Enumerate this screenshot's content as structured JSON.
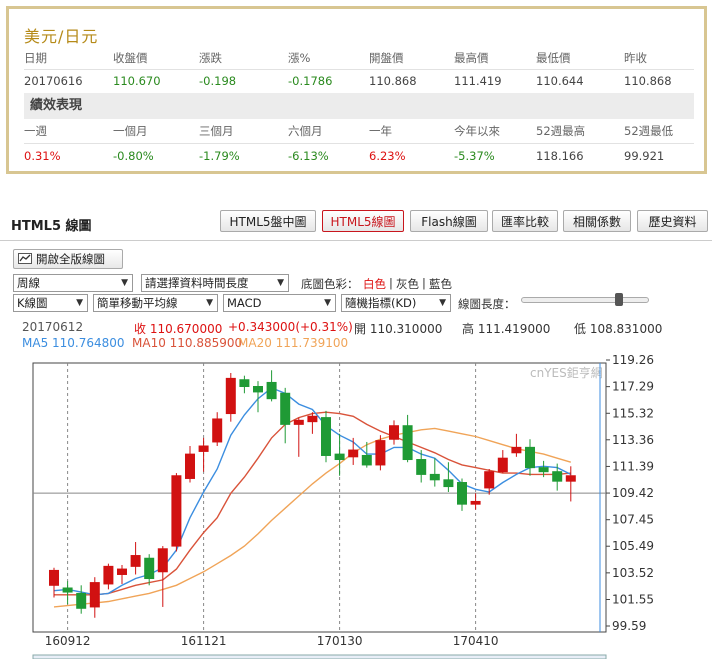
{
  "quote": {
    "title": "美元/日元",
    "headers": [
      "日期",
      "收盤價",
      "漲跌",
      "漲%",
      "開盤價",
      "最高價",
      "最低價",
      "昨收"
    ],
    "values": [
      "20170616",
      "110.670",
      "-0.198",
      "-0.1786",
      "110.868",
      "111.419",
      "110.644",
      "110.868"
    ],
    "perf_title": "績效表現",
    "perf_headers": [
      "一週",
      "一個月",
      "三個月",
      "六個月",
      "一年",
      "今年以來",
      "52週最高",
      "52週最低"
    ],
    "perf_values": [
      "0.31%",
      "-0.80%",
      "-1.79%",
      "-6.13%",
      "6.23%",
      "-5.37%",
      "118.166",
      "99.921"
    ]
  },
  "html5": {
    "title": "HTML5 線圖",
    "tabs": [
      "HTML5盤中圖",
      "HTML5線圖",
      "Flash線圖",
      "匯率比較",
      "相關係數",
      "歷史資料"
    ],
    "active_tab": "HTML5線圖",
    "full_button": "開啟全版線圖",
    "period_select": "周線",
    "range_select": "請選擇資料時間長度",
    "bg_label": "底圖色彩：",
    "bg_white": "白色",
    "bg_gray": "灰色",
    "bg_blue": "藍色",
    "chart_type_select": "K線圖",
    "ma_select": "簡單移動平均線",
    "indicator1_select": "MACD",
    "indicator2_select": "隨機指標(KD)",
    "length_label": "線圖長度："
  },
  "info": {
    "date": "20170612",
    "close": "收 110.670000",
    "change": "+0.343000(+0.31%)",
    "open": "開 110.310000",
    "high": "高 111.419000",
    "low": "低 108.831000",
    "ma5": "MA5 110.764800",
    "ma10": "MA10 110.885900",
    "ma20": "MA20 111.739100"
  },
  "colors": {
    "up": "#d11111",
    "down": "#1f9a35",
    "ma5": "#3c8ee0",
    "ma10": "#d9533a",
    "ma20": "#f0a458",
    "accent_border": "#d8c692",
    "title_gold": "#b58a18"
  },
  "chart_data": {
    "type": "candlestick",
    "watermark": "cnYES鉅亨網",
    "yticks": [
      "119.26",
      "117.29",
      "115.32",
      "113.36",
      "111.39",
      "109.42",
      "107.45",
      "105.49",
      "103.52",
      "101.55",
      "99.59"
    ],
    "ylim": [
      99.59,
      119.26
    ],
    "xticks": [
      {
        "label": "160912",
        "index": 1
      },
      {
        "label": "161121",
        "index": 11
      },
      {
        "label": "170130",
        "index": 21
      },
      {
        "label": "170410",
        "index": 31
      }
    ],
    "candles": [
      {
        "o": 102.6,
        "h": 103.9,
        "l": 101.7,
        "c": 103.7
      },
      {
        "o": 102.4,
        "h": 102.9,
        "l": 101.2,
        "c": 102.1
      },
      {
        "o": 102.0,
        "h": 102.6,
        "l": 100.5,
        "c": 100.9
      },
      {
        "o": 101.0,
        "h": 103.2,
        "l": 100.2,
        "c": 102.8
      },
      {
        "o": 102.7,
        "h": 104.2,
        "l": 102.3,
        "c": 104.0
      },
      {
        "o": 103.4,
        "h": 104.1,
        "l": 102.7,
        "c": 103.8
      },
      {
        "o": 104.0,
        "h": 105.8,
        "l": 103.4,
        "c": 104.8
      },
      {
        "o": 104.6,
        "h": 104.9,
        "l": 102.6,
        "c": 103.1
      },
      {
        "o": 103.6,
        "h": 105.5,
        "l": 101.0,
        "c": 105.3
      },
      {
        "o": 105.5,
        "h": 110.9,
        "l": 105.1,
        "c": 110.7
      },
      {
        "o": 110.5,
        "h": 112.9,
        "l": 110.2,
        "c": 112.3
      },
      {
        "o": 112.5,
        "h": 113.5,
        "l": 111.0,
        "c": 112.9
      },
      {
        "o": 113.2,
        "h": 115.4,
        "l": 112.9,
        "c": 114.9
      },
      {
        "o": 115.3,
        "h": 118.3,
        "l": 114.7,
        "c": 117.9
      },
      {
        "o": 117.8,
        "h": 118.1,
        "l": 116.8,
        "c": 117.3
      },
      {
        "o": 117.3,
        "h": 117.7,
        "l": 115.4,
        "c": 116.9
      },
      {
        "o": 117.6,
        "h": 118.5,
        "l": 116.2,
        "c": 116.4
      },
      {
        "o": 116.8,
        "h": 117.2,
        "l": 113.1,
        "c": 114.5
      },
      {
        "o": 114.5,
        "h": 115.0,
        "l": 112.1,
        "c": 114.8
      },
      {
        "o": 114.7,
        "h": 115.4,
        "l": 113.8,
        "c": 115.1
      },
      {
        "o": 115.0,
        "h": 115.5,
        "l": 111.7,
        "c": 112.2
      },
      {
        "o": 112.3,
        "h": 113.8,
        "l": 110.7,
        "c": 111.9
      },
      {
        "o": 112.1,
        "h": 113.5,
        "l": 111.5,
        "c": 112.6
      },
      {
        "o": 112.2,
        "h": 113.2,
        "l": 111.3,
        "c": 111.5
      },
      {
        "o": 111.5,
        "h": 113.7,
        "l": 111.1,
        "c": 113.3
      },
      {
        "o": 113.4,
        "h": 114.8,
        "l": 113.0,
        "c": 114.4
      },
      {
        "o": 114.4,
        "h": 115.2,
        "l": 111.7,
        "c": 111.9
      },
      {
        "o": 111.9,
        "h": 112.6,
        "l": 110.2,
        "c": 110.8
      },
      {
        "o": 110.8,
        "h": 112.0,
        "l": 109.9,
        "c": 110.4
      },
      {
        "o": 110.4,
        "h": 111.7,
        "l": 109.5,
        "c": 109.9
      },
      {
        "o": 110.2,
        "h": 110.5,
        "l": 108.1,
        "c": 108.6
      },
      {
        "o": 108.6,
        "h": 109.4,
        "l": 108.2,
        "c": 108.8
      },
      {
        "o": 109.8,
        "h": 111.2,
        "l": 109.3,
        "c": 111.0
      },
      {
        "o": 111.0,
        "h": 112.6,
        "l": 110.9,
        "c": 112.0
      },
      {
        "o": 112.4,
        "h": 113.8,
        "l": 112.1,
        "c": 112.8
      },
      {
        "o": 112.8,
        "h": 113.4,
        "l": 110.7,
        "c": 111.3
      },
      {
        "o": 111.3,
        "h": 111.8,
        "l": 110.6,
        "c": 111.0
      },
      {
        "o": 111.0,
        "h": 111.6,
        "l": 109.6,
        "c": 110.3
      },
      {
        "o": 110.3,
        "h": 111.4,
        "l": 108.8,
        "c": 110.7
      }
    ],
    "ma5": [
      102.2,
      102.3,
      102.1,
      101.9,
      102.0,
      102.6,
      103.1,
      103.4,
      103.9,
      105.2,
      107.6,
      109.5,
      111.2,
      113.7,
      115.2,
      116.4,
      117.2,
      116.8,
      116.0,
      115.6,
      114.4,
      113.7,
      113.2,
      112.3,
      112.3,
      112.8,
      112.8,
      112.3,
      112.0,
      111.1,
      110.1,
      109.7,
      109.5,
      110.2,
      110.8,
      111.3,
      111.4,
      111.3,
      110.8
    ],
    "ma10": [
      101.9,
      101.9,
      101.9,
      101.9,
      102.0,
      102.3,
      102.6,
      102.8,
      103.0,
      103.8,
      105.2,
      106.5,
      107.6,
      109.4,
      110.6,
      112.0,
      113.5,
      114.5,
      115.0,
      115.3,
      115.4,
      115.3,
      115.1,
      114.5,
      114.0,
      113.6,
      113.2,
      112.8,
      112.4,
      111.9,
      111.5,
      111.3,
      111.1,
      110.9,
      110.9,
      110.8,
      110.8,
      110.8,
      110.9
    ],
    "ma20": [
      101.0,
      101.1,
      101.2,
      101.3,
      101.4,
      101.6,
      101.8,
      102.0,
      102.3,
      102.6,
      103.1,
      103.6,
      104.2,
      104.8,
      105.5,
      106.4,
      107.4,
      108.3,
      109.2,
      110.1,
      110.9,
      111.6,
      112.4,
      113.0,
      113.4,
      113.7,
      113.9,
      114.1,
      114.2,
      114.0,
      113.8,
      113.6,
      113.3,
      113.0,
      112.7,
      112.5,
      112.3,
      112.0,
      111.7
    ]
  }
}
